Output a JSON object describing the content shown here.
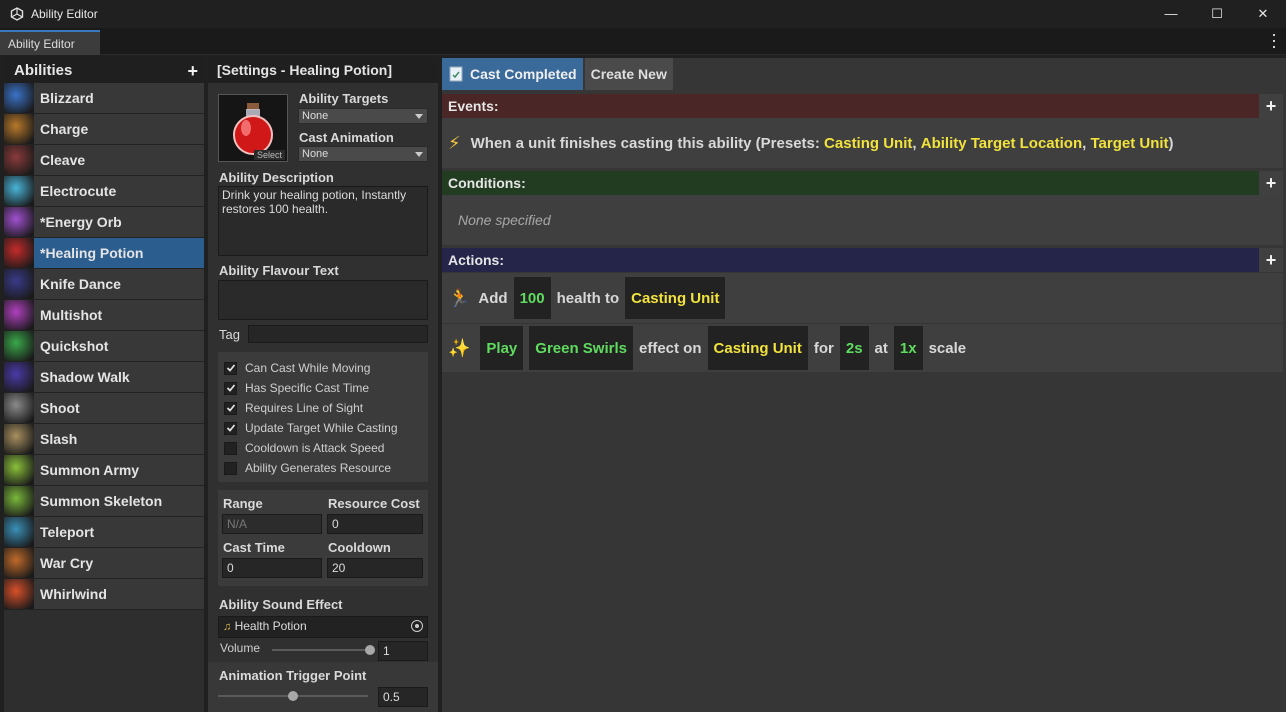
{
  "window": {
    "title": "Ability Editor",
    "tab_label": "Ability Editor",
    "controls": {
      "minimize": "—",
      "maximize": "☐",
      "close": "✕"
    }
  },
  "abilities": {
    "header": "Abilities",
    "add_label": "+",
    "items": [
      {
        "label": "Blizzard",
        "color": "#3a72c8"
      },
      {
        "label": "Charge",
        "color": "#b8782a"
      },
      {
        "label": "Cleave",
        "color": "#8a3a3a"
      },
      {
        "label": "Electrocute",
        "color": "#4ab4d8"
      },
      {
        "label": "*Energy Orb",
        "color": "#a050d0"
      },
      {
        "label": "*Healing Potion",
        "color": "#c42a2a"
      },
      {
        "label": "Knife Dance",
        "color": "#3a3a8a"
      },
      {
        "label": "Multishot",
        "color": "#b040c0"
      },
      {
        "label": "Quickshot",
        "color": "#3aa84a"
      },
      {
        "label": "Shadow Walk",
        "color": "#4a3aa8"
      },
      {
        "label": "Shoot",
        "color": "#8a8a8a"
      },
      {
        "label": "Slash",
        "color": "#a89060"
      },
      {
        "label": "Summon Army",
        "color": "#8ac03a"
      },
      {
        "label": "Summon Skeleton",
        "color": "#7ab83a"
      },
      {
        "label": "Teleport",
        "color": "#3a90b8"
      },
      {
        "label": "War Cry",
        "color": "#c06a2a"
      },
      {
        "label": "Whirlwind",
        "color": "#d8502a"
      }
    ],
    "selected_index": 5
  },
  "settings": {
    "header": "[Settings - Healing Potion]",
    "icon_select_label": "Select",
    "ability_targets_label": "Ability Targets",
    "ability_targets_value": "None",
    "cast_animation_label": "Cast Animation",
    "cast_animation_value": "None",
    "description_label": "Ability Description",
    "description_value": "Drink your healing potion, Instantly restores 100 health.",
    "flavour_label": "Ability Flavour Text",
    "flavour_value": "",
    "tag_label": "Tag",
    "tag_value": "",
    "checkboxes": [
      {
        "label": "Can Cast While Moving",
        "checked": true
      },
      {
        "label": "Has Specific Cast Time",
        "checked": true
      },
      {
        "label": "Requires Line of Sight",
        "checked": true
      },
      {
        "label": "Update Target While Casting",
        "checked": true
      },
      {
        "label": "Cooldown is Attack Speed",
        "checked": false
      },
      {
        "label": "Ability Generates Resource",
        "checked": false
      }
    ],
    "range_label": "Range",
    "range_value": "N/A",
    "resource_cost_label": "Resource Cost",
    "resource_cost_value": "0",
    "cast_time_label": "Cast Time",
    "cast_time_value": "0",
    "cooldown_label": "Cooldown",
    "cooldown_value": "20",
    "sound_label": "Ability Sound Effect",
    "sound_value": "Health Potion",
    "volume_label": "Volume",
    "volume_value": "1",
    "volume_level": 1.0,
    "anim_trigger_label": "Animation Trigger Point",
    "anim_trigger_value": "0.5",
    "anim_trigger_level": 0.5
  },
  "editor": {
    "tabs": [
      "Cast Completed",
      "Create New"
    ],
    "events_label": "Events:",
    "event_text_prefix": "When a unit finishes casting this ability (Presets: ",
    "event_presets": [
      "Casting Unit",
      "Ability Target Location",
      "Target Unit"
    ],
    "event_sep": ", ",
    "event_text_suffix": ")",
    "conditions_label": "Conditions:",
    "conditions_empty": "None specified",
    "actions_label": "Actions:",
    "action1": {
      "verb": "Add",
      "amount": "100",
      "mid": "health to",
      "target": "Casting Unit"
    },
    "action2": {
      "verb": "Play",
      "effect": "Green Swirls",
      "mid": "effect on",
      "target": "Casting Unit",
      "for": "for",
      "duration": "2s",
      "at": "at",
      "scale": "1x",
      "scale_word": "scale"
    },
    "colors": {
      "events": "#4a2626",
      "conditions": "#223c22",
      "actions": "#25254a",
      "keyword": "#f1e23d",
      "value": "#5fdc5f"
    }
  }
}
